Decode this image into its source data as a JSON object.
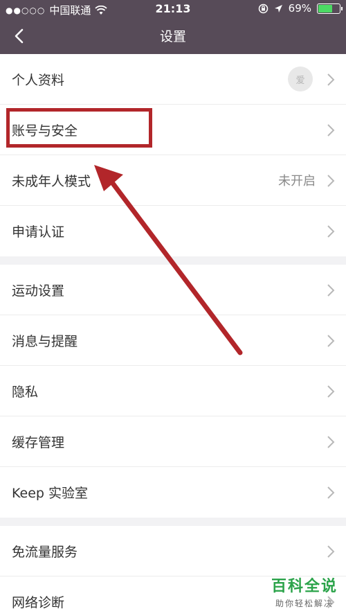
{
  "status_bar": {
    "signal_dots": "●●○○○",
    "carrier": "中国联通",
    "time": "21:13",
    "battery_percent": "69%",
    "battery_level": 0.69
  },
  "nav": {
    "title": "设置"
  },
  "groups": [
    {
      "items": [
        {
          "label": "个人资料",
          "avatar_text": "爱"
        },
        {
          "label": "账号与安全"
        },
        {
          "label": "未成年人模式",
          "value": "未开启"
        },
        {
          "label": "申请认证"
        }
      ]
    },
    {
      "items": [
        {
          "label": "运动设置"
        },
        {
          "label": "消息与提醒"
        },
        {
          "label": "隐私"
        },
        {
          "label": "缓存管理"
        },
        {
          "label": "Keep 实验室"
        }
      ]
    },
    {
      "items": [
        {
          "label": "免流量服务"
        },
        {
          "label": "网络诊断"
        }
      ]
    }
  ],
  "watermark": {
    "main": "百科全说",
    "sub": "助你轻松解决"
  },
  "colors": {
    "header_bg": "#574b58",
    "annotation_red": "#b2262a",
    "battery_green": "#4cd964",
    "watermark_green": "#2ba34a"
  }
}
